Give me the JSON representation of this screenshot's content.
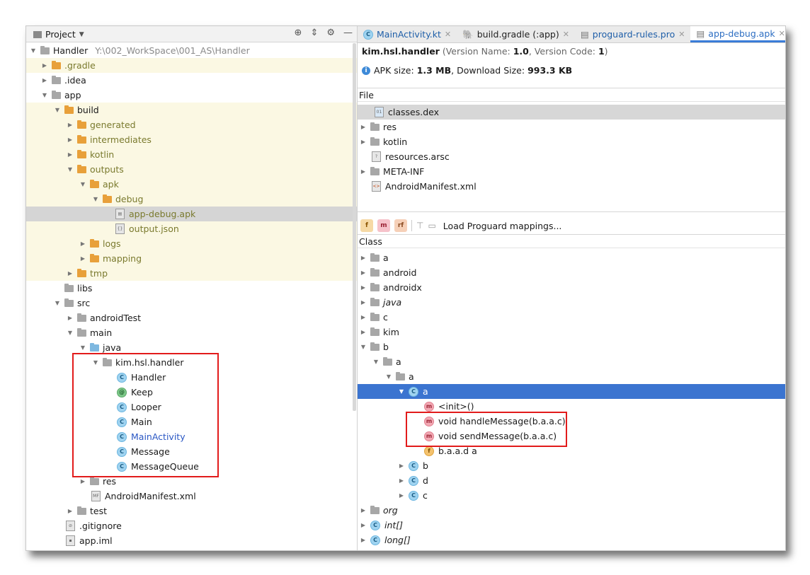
{
  "project_panel": {
    "title": "Project",
    "root": {
      "name": "Handler",
      "path": "Y:\\002_WorkSpace\\001_AS\\Handler"
    },
    "items": [
      {
        "label": ".gradle"
      },
      {
        "label": ".idea"
      },
      {
        "label": "app"
      },
      {
        "label": "build"
      },
      {
        "label": "generated"
      },
      {
        "label": "intermediates"
      },
      {
        "label": "kotlin"
      },
      {
        "label": "outputs"
      },
      {
        "label": "apk"
      },
      {
        "label": "debug"
      },
      {
        "label": "app-debug.apk"
      },
      {
        "label": "output.json"
      },
      {
        "label": "logs"
      },
      {
        "label": "mapping"
      },
      {
        "label": "tmp"
      },
      {
        "label": "libs"
      },
      {
        "label": "src"
      },
      {
        "label": "androidTest"
      },
      {
        "label": "main"
      },
      {
        "label": "java"
      },
      {
        "label": "kim.hsl.handler"
      },
      {
        "label": "Handler"
      },
      {
        "label": "Keep"
      },
      {
        "label": "Looper"
      },
      {
        "label": "Main"
      },
      {
        "label": "MainActivity"
      },
      {
        "label": "Message"
      },
      {
        "label": "MessageQueue"
      },
      {
        "label": "res"
      },
      {
        "label": "AndroidManifest.xml"
      },
      {
        "label": "test"
      },
      {
        "label": ".gitignore"
      },
      {
        "label": "app.iml"
      }
    ]
  },
  "tabs": [
    {
      "label": "MainActivity.kt"
    },
    {
      "label": "build.gradle (:app)"
    },
    {
      "label": "proguard-rules.pro"
    },
    {
      "label": "app-debug.apk"
    }
  ],
  "apk": {
    "package": "kim.hsl.handler",
    "version_open": " (Version Name: ",
    "version_name": "1.0",
    "version_mid": ", Version Code: ",
    "version_code": "1",
    "version_close": ")",
    "size_prefix": "APK size: ",
    "apk_size": "1.3 MB",
    "download_prefix": ", Download Size: ",
    "download_size": "993.3 KB"
  },
  "file_header": "File",
  "files": [
    {
      "label": "classes.dex"
    },
    {
      "label": "res"
    },
    {
      "label": "kotlin"
    },
    {
      "label": "resources.arsc"
    },
    {
      "label": "META-INF"
    },
    {
      "label": "AndroidManifest.xml"
    }
  ],
  "proguard": {
    "btn_f": "f",
    "btn_m": "m",
    "btn_rf": "rf",
    "load_label": "Load Proguard mappings..."
  },
  "class_header": "Class",
  "classes": [
    {
      "label": "a"
    },
    {
      "label": "android"
    },
    {
      "label": "androidx"
    },
    {
      "label": "java"
    },
    {
      "label": "c"
    },
    {
      "label": "kim"
    },
    {
      "label": "b"
    },
    {
      "label": "a"
    },
    {
      "label": "a"
    },
    {
      "label": "a"
    },
    {
      "label": "<init>()"
    },
    {
      "label": "void handleMessage(b.a.a.c)"
    },
    {
      "label": "void sendMessage(b.a.a.c)"
    },
    {
      "label": "b.a.a.d a"
    },
    {
      "label": "b"
    },
    {
      "label": "d"
    },
    {
      "label": "c"
    },
    {
      "label": "org"
    },
    {
      "label": "int[]"
    },
    {
      "label": "long[]"
    }
  ],
  "colors": {
    "highlight_row": "#fbf8e3",
    "selection_blue": "#3b74d0",
    "annotation_red": "#e21b1b",
    "folder_orange": "#e8a03a"
  }
}
